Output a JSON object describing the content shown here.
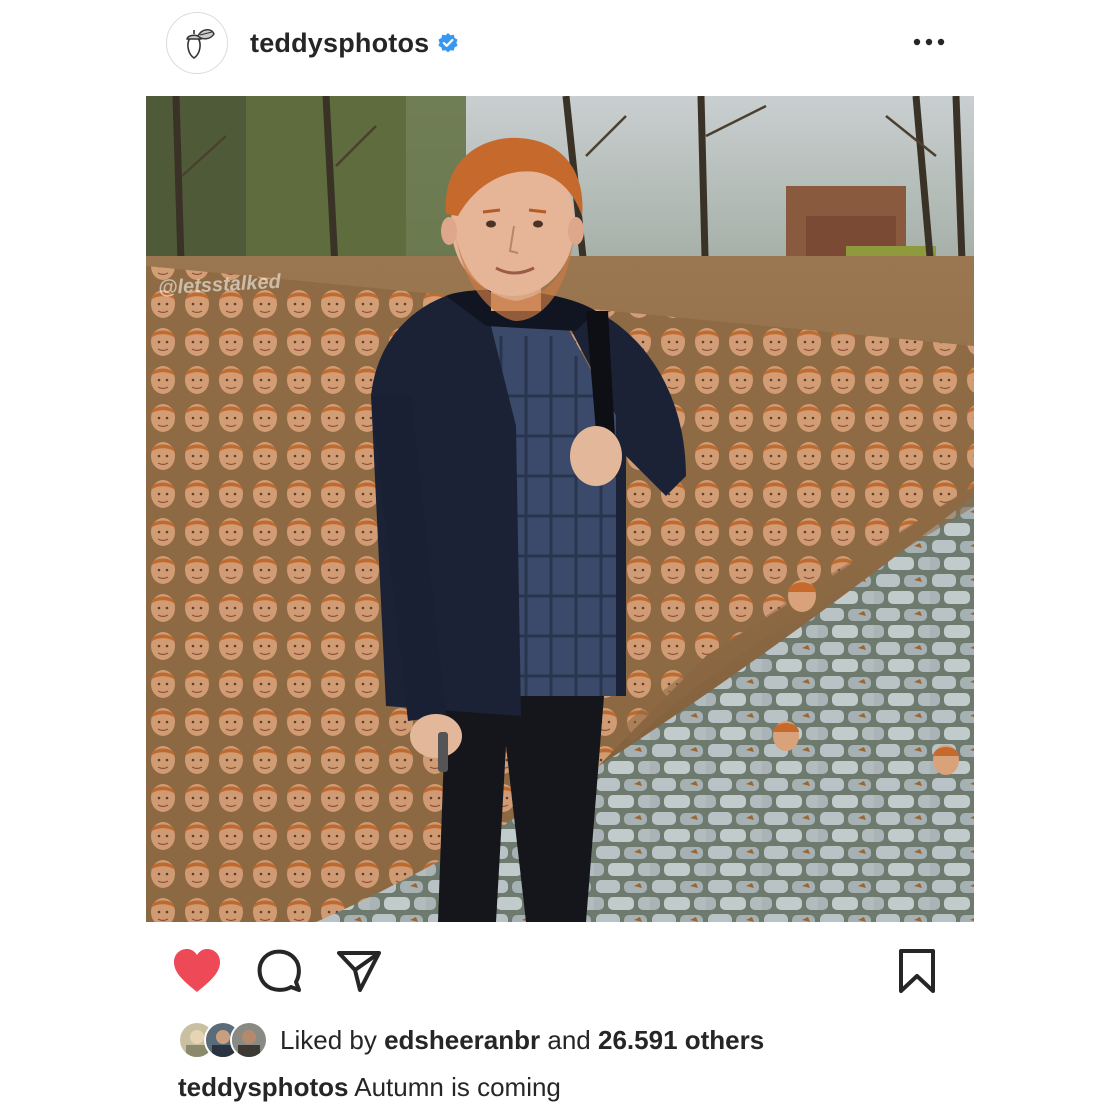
{
  "post": {
    "username": "teddysphotos",
    "verified": true,
    "more_icon": "more-horizontal-icon",
    "avatar_icon": "acorn-icon",
    "watermark": "@letsstalked",
    "actions": {
      "like_icon": "heart-icon",
      "liked": true,
      "comment_icon": "comment-icon",
      "share_icon": "share-icon",
      "save_icon": "bookmark-icon"
    },
    "likes": {
      "prefix": "Liked by",
      "user": "edsheeranbr",
      "joiner": "and",
      "count": "26.591 others"
    },
    "caption": {
      "username": "teddysphotos",
      "text": "Autumn is coming"
    }
  },
  "colors": {
    "like": "#ed4956",
    "verified": "#3897f0",
    "text": "#262626"
  }
}
